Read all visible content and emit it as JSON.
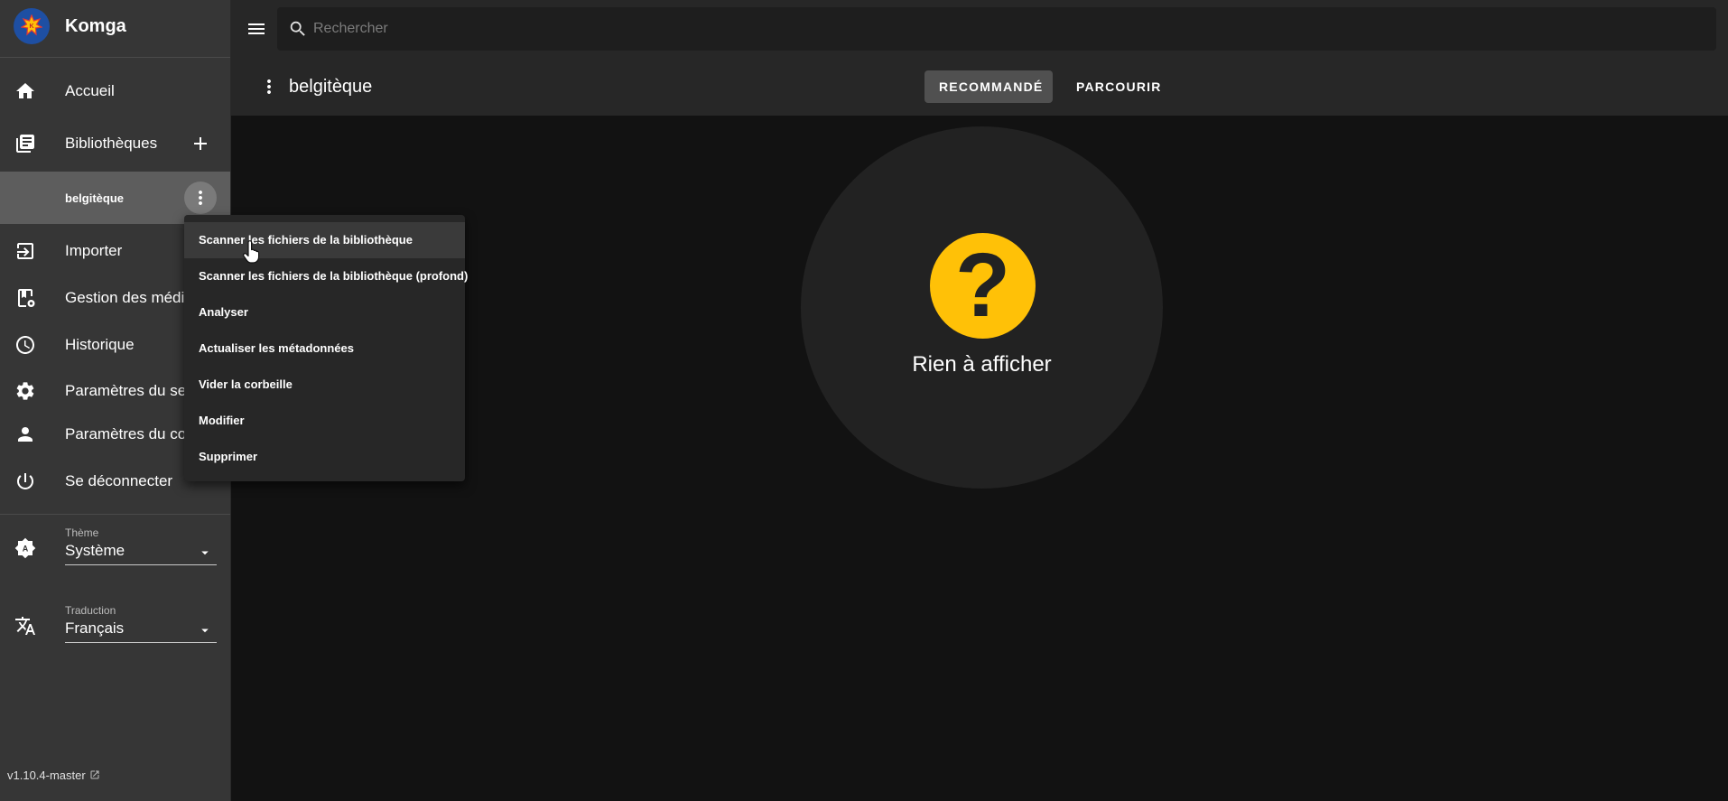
{
  "app": {
    "title": "Komga",
    "version": "v1.10.4-master"
  },
  "nav": {
    "home": "Accueil",
    "libraries": "Bibliothèques",
    "library_item": "belgitèque",
    "import": "Importer",
    "media": "Gestion des média",
    "history": "Historique",
    "server_settings": "Paramètres du ser",
    "account_settings": "Paramètres du con",
    "logout": "Se déconnecter"
  },
  "theme": {
    "caption": "Thème",
    "value": "Système"
  },
  "translation": {
    "caption": "Traduction",
    "value": "Français"
  },
  "search": {
    "placeholder": "Rechercher"
  },
  "library_bar": {
    "title": "belgitèque",
    "tab_recommended": "RECOMMANDÉ",
    "tab_browse": "PARCOURIR"
  },
  "empty_state": {
    "text": "Rien à afficher"
  },
  "context_menu": {
    "items": [
      "Scanner les fichiers de la bibliothèque",
      "Scanner les fichiers de la bibliothèque (profond)",
      "Analyser",
      "Actualiser les métadonnées",
      "Vider la corbeille",
      "Modifier",
      "Supprimer"
    ]
  },
  "colors": {
    "accent": "#ffc107",
    "sidebar_bg": "#363636",
    "topbar_bg": "#272727",
    "content_bg": "#121212"
  }
}
